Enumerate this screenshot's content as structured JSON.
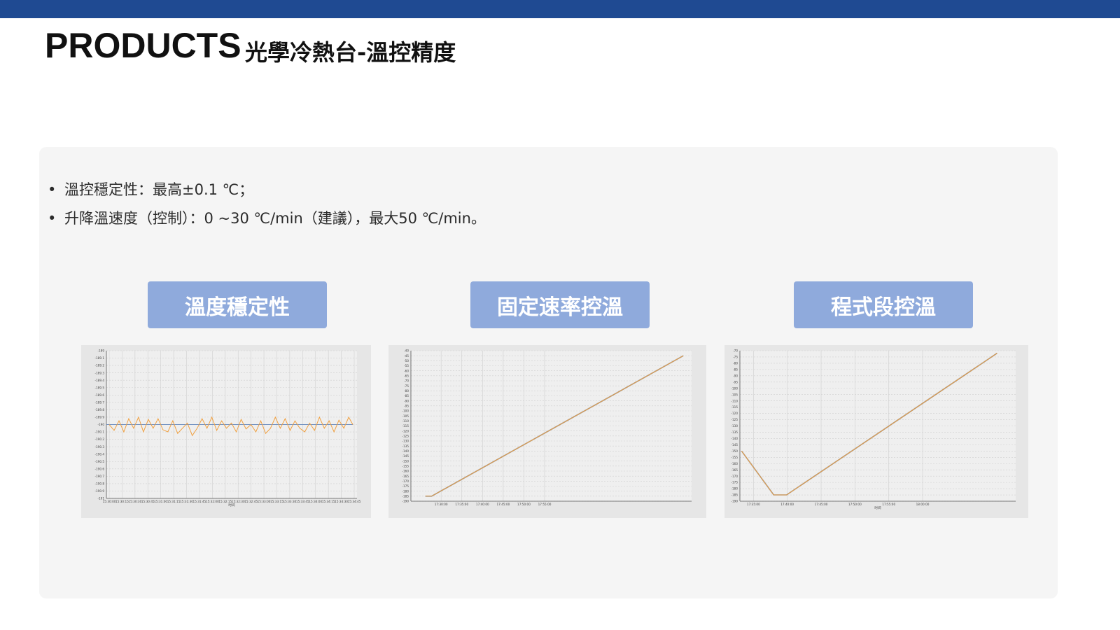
{
  "header": {
    "title_en": "PRODUCTS",
    "title_zh": "光學冷熱台-溫控精度"
  },
  "bullets": [
    "溫控穩定性：最高±0.1 ℃；",
    "升降溫速度（控制）：0 ~30 ℃/min（建議），最大50 ℃/min。"
  ],
  "labels": [
    "溫度穩定性",
    "固定速率控溫",
    "程式段控溫"
  ],
  "colors": {
    "topbar": "#1f4a92",
    "chip": "#8faadc",
    "series": "#f0a040",
    "setpoint": "#6f8fc0",
    "grid": "#cfcfcf"
  },
  "chart_data": [
    {
      "type": "line",
      "xlabel": "时间",
      "xticks": [
        "15:30:00",
        "15:30:15",
        "15:30:30",
        "15:30:45",
        "15:31:00",
        "15:31:15",
        "15:31:30",
        "15:31:45",
        "15:32:00",
        "15:32:15",
        "15:32:30",
        "15:32:45",
        "15:33:00",
        "15:33:15",
        "15:33:30",
        "15:33:45",
        "15:34:00",
        "15:34:15",
        "15:34:30",
        "15:34:45"
      ],
      "yticks": [
        "-189",
        "-189.1",
        "-189.2",
        "-189.3",
        "-189.4",
        "-189.5",
        "-189.6",
        "-189.7",
        "-189.8",
        "-189.9",
        "-190",
        "-190.1",
        "-190.2",
        "-190.3",
        "-190.4",
        "-190.5",
        "-190.6",
        "-190.7",
        "-190.8",
        "-190.9",
        "-191"
      ],
      "ylim": [
        -191,
        -189
      ],
      "setpoint": -190,
      "series": [
        {
          "x": [
            0,
            6,
            12,
            18,
            24,
            30,
            36,
            42,
            48,
            54,
            60,
            66,
            72,
            78,
            84,
            90,
            96,
            102,
            108,
            114,
            120,
            126,
            132,
            138,
            144,
            150,
            156,
            162,
            168,
            174,
            180,
            186,
            192,
            198,
            204,
            210,
            216,
            222,
            228,
            234,
            240,
            246,
            252,
            258,
            264,
            270,
            276,
            282,
            288,
            294,
            299
          ],
          "y": [
            -190.0,
            -190.08,
            -189.95,
            -190.1,
            -189.92,
            -190.05,
            -189.9,
            -190.1,
            -189.93,
            -190.05,
            -189.92,
            -190.07,
            -190.1,
            -189.95,
            -190.12,
            -190.05,
            -189.98,
            -190.15,
            -190.05,
            -189.92,
            -190.05,
            -189.9,
            -190.08,
            -189.95,
            -190.05,
            -189.98,
            -190.1,
            -189.93,
            -190.06,
            -190.0,
            -190.1,
            -189.95,
            -190.12,
            -190.05,
            -189.9,
            -190.05,
            -189.92,
            -190.08,
            -189.95,
            -190.05,
            -190.1,
            -189.98,
            -190.08,
            -189.9,
            -190.05,
            -189.95,
            -190.1,
            -189.94,
            -190.05,
            -189.9,
            -190.0
          ]
        }
      ]
    },
    {
      "type": "line",
      "xticks": [
        "17:30:00",
        "17:35:00",
        "17:40:00",
        "17:45:00",
        "17:50:00",
        "17:55:00"
      ],
      "yticks": [
        "-40",
        "-45",
        "-50",
        "-55",
        "-60",
        "-65",
        "-70",
        "-75",
        "-80",
        "-85",
        "-90",
        "-95",
        "-100",
        "-105",
        "-110",
        "-115",
        "-120",
        "-125",
        "-130",
        "-135",
        "-140",
        "-145",
        "-150",
        "-155",
        "-160",
        "-165",
        "-170",
        "-175",
        "-180",
        "-185",
        "-190"
      ],
      "ylim": [
        -190,
        -40
      ],
      "series": [
        {
          "x": [
            -3.8,
            -2.3,
            58.5
          ],
          "y": [
            -185,
            -185,
            -45
          ]
        }
      ]
    },
    {
      "type": "line",
      "xlabel": "时间",
      "xticks": [
        "17:35:00",
        "17:40:00",
        "17:45:00",
        "17:50:00",
        "17:55:00",
        "18:00:00"
      ],
      "yticks": [
        "-70",
        "-75",
        "-80",
        "-85",
        "-90",
        "-95",
        "-100",
        "-105",
        "-110",
        "-115",
        "-120",
        "-125",
        "-130",
        "-135",
        "-140",
        "-145",
        "-150",
        "-155",
        "-160",
        "-165",
        "-170",
        "-175",
        "-180",
        "-185",
        "-190"
      ],
      "ylim": [
        -190,
        -70
      ],
      "series": [
        {
          "x": [
            -3.5,
            6.0,
            9.8,
            72.0
          ],
          "y": [
            -150,
            -185,
            -185,
            -72
          ]
        }
      ]
    }
  ]
}
